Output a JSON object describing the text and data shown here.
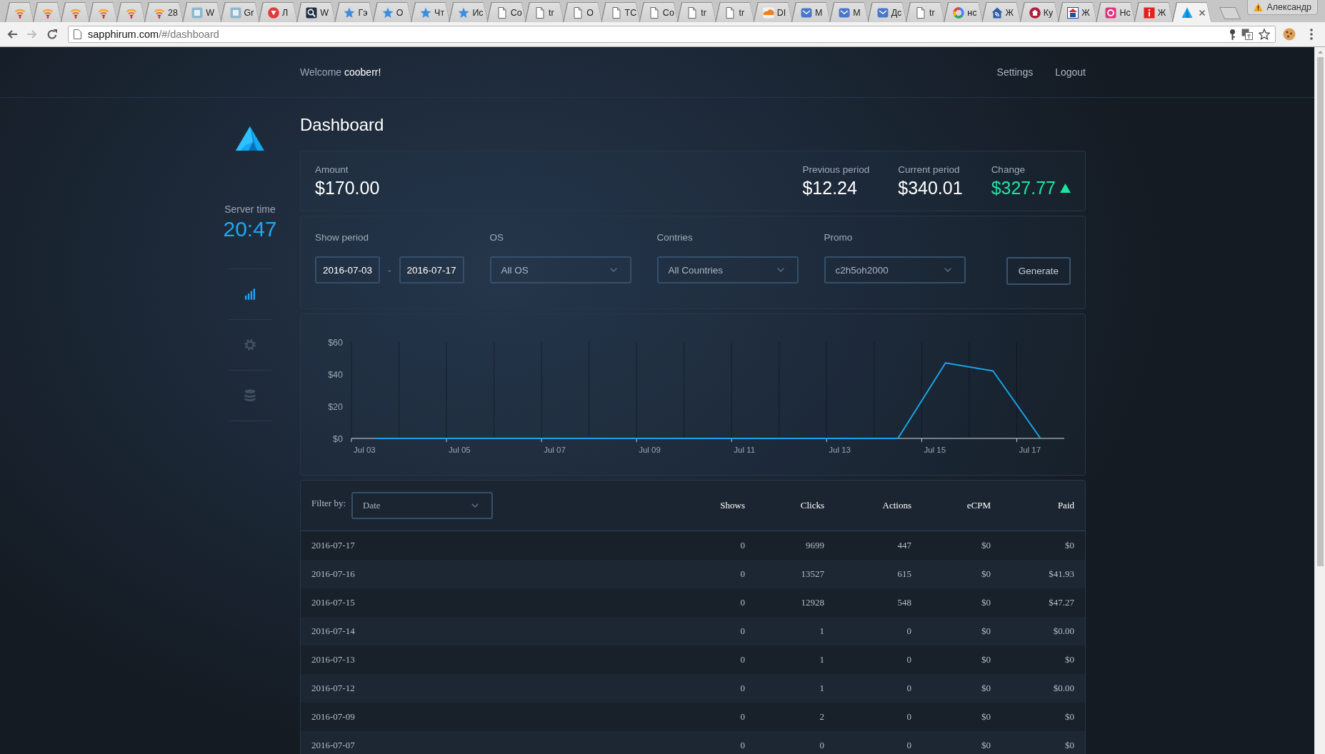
{
  "browser": {
    "tabs": [
      {
        "kind": "feed",
        "pinned": true,
        "selected": false
      },
      {
        "kind": "feed",
        "pinned": true,
        "selected": false
      },
      {
        "kind": "feed",
        "pinned": true,
        "selected": false
      },
      {
        "kind": "feed",
        "pinned": true,
        "selected": false
      },
      {
        "kind": "feed",
        "pinned": true,
        "selected": false
      },
      {
        "kind": "feed",
        "label": "28",
        "pinned": false,
        "selected": false
      },
      {
        "kind": "tile",
        "label": "W",
        "pinned": false,
        "selected": false
      },
      {
        "kind": "tile",
        "label": "Gr",
        "pinned": false,
        "selected": false
      },
      {
        "kind": "badge",
        "label": "Л",
        "pinned": false,
        "selected": false
      },
      {
        "kind": "globe",
        "label": "W",
        "pinned": false,
        "selected": false
      },
      {
        "kind": "star",
        "label": "Гэ",
        "pinned": false,
        "selected": false
      },
      {
        "kind": "star",
        "label": "O",
        "pinned": false,
        "selected": false
      },
      {
        "kind": "star",
        "label": "Чт",
        "pinned": false,
        "selected": false
      },
      {
        "kind": "star",
        "label": "Ис",
        "pinned": false,
        "selected": false
      },
      {
        "kind": "page",
        "label": "Co",
        "pinned": false,
        "selected": false
      },
      {
        "kind": "page",
        "label": "tr",
        "pinned": false,
        "selected": false
      },
      {
        "kind": "page",
        "label": "O",
        "pinned": false,
        "selected": false
      },
      {
        "kind": "page",
        "label": "TC",
        "pinned": false,
        "selected": false
      },
      {
        "kind": "page",
        "label": "Co",
        "pinned": false,
        "selected": false
      },
      {
        "kind": "page",
        "label": "tr",
        "pinned": false,
        "selected": false
      },
      {
        "kind": "page",
        "label": "tr",
        "pinned": false,
        "selected": false
      },
      {
        "kind": "cloud",
        "label": "DI",
        "pinned": false,
        "selected": false
      },
      {
        "kind": "mail",
        "label": "M",
        "pinned": false,
        "selected": false
      },
      {
        "kind": "mail",
        "label": "M",
        "pinned": false,
        "selected": false
      },
      {
        "kind": "mail",
        "label": "Дс",
        "pinned": false,
        "selected": false
      },
      {
        "kind": "page",
        "label": "tr",
        "pinned": false,
        "selected": false
      },
      {
        "kind": "google",
        "label": "нс",
        "pinned": false,
        "selected": false
      },
      {
        "kind": "house",
        "label": "Ж",
        "pinned": false,
        "selected": false
      },
      {
        "kind": "dome",
        "label": "Ку",
        "pinned": false,
        "selected": false
      },
      {
        "kind": "building",
        "label": "Ж",
        "pinned": false,
        "selected": false
      },
      {
        "kind": "ring",
        "label": "Нс",
        "pinned": false,
        "selected": false
      },
      {
        "kind": "info",
        "label": "Ж",
        "pinned": false,
        "selected": false
      },
      {
        "kind": "app",
        "pinned": false,
        "selected": true
      }
    ],
    "profile": "Александр",
    "nav": [
      {
        "kind": "back",
        "disabled": false
      },
      {
        "kind": "forward",
        "disabled": true
      },
      {
        "kind": "reload",
        "disabled": false
      }
    ],
    "address": {
      "host": "sapphirum.com",
      "path": "/#/dashboard"
    }
  },
  "header": {
    "welcome": "Welcome",
    "user": "cooberr!",
    "links": [
      "Settings",
      "Logout"
    ]
  },
  "sidebar": {
    "server_time_label": "Server time",
    "server_time": "20:47",
    "nav": [
      {
        "kind": "stats",
        "selected": true
      },
      {
        "kind": "settings",
        "selected": false
      },
      {
        "kind": "database",
        "selected": false
      }
    ]
  },
  "page_title": "Dashboard",
  "summary": {
    "amount": {
      "label": "Amount",
      "value": "$170.00"
    },
    "periods": [
      {
        "label": "Previous period",
        "value": "$12.24",
        "up": false
      },
      {
        "label": "Current period",
        "value": "$340.01",
        "up": false
      },
      {
        "label": "Change",
        "value": "$327.77",
        "up": true
      }
    ]
  },
  "filters": {
    "period": {
      "label": "Show period",
      "from": "2016-07-03",
      "separator": "-",
      "to": "2016-07-17"
    },
    "selects": [
      {
        "label": "OS",
        "value": "All OS"
      },
      {
        "label": "Contries",
        "value": "All Countries"
      },
      {
        "label": "Promo",
        "value": "c2h5oh2000"
      }
    ],
    "button": "Generate"
  },
  "chart": {
    "chart_data": [
      {
        "type": "line",
        "categories": [
          "Jul 03",
          null,
          "Jul 05",
          null,
          "Jul 07",
          null,
          "Jul 09",
          null,
          "Jul 11",
          null,
          "Jul 13",
          null,
          "Jul 15",
          null,
          "Jul 17"
        ],
        "values": [
          0,
          0,
          0,
          0,
          0,
          0,
          0,
          0,
          0,
          0,
          0,
          0,
          47,
          42,
          0
        ],
        "color": "#1aa3e8",
        "ylim": [
          0,
          60
        ],
        "yticks": [
          {
            "value": 0,
            "label": "$0"
          },
          {
            "value": 20,
            "label": "$20"
          },
          {
            "value": 40,
            "label": "$40"
          },
          {
            "value": 60,
            "label": "$60"
          }
        ],
        "grid": true
      }
    ]
  },
  "table": {
    "columns": [
      {
        "kind": "filter",
        "label": "Filter by:",
        "value": "Date"
      },
      {
        "kind": "text",
        "label": "Shows"
      },
      {
        "kind": "text",
        "label": "Clicks"
      },
      {
        "kind": "text",
        "label": "Actions"
      },
      {
        "kind": "text",
        "label": "eCPM"
      },
      {
        "kind": "text",
        "label": "Paid"
      }
    ],
    "rows": [
      [
        "2016-07-17",
        "0",
        "9699",
        "447",
        "$0",
        "$0"
      ],
      [
        "2016-07-16",
        "0",
        "13527",
        "615",
        "$0",
        "$41.93"
      ],
      [
        "2016-07-15",
        "0",
        "12928",
        "548",
        "$0",
        "$47.27"
      ],
      [
        "2016-07-14",
        "0",
        "1",
        "0",
        "$0",
        "$0.00"
      ],
      [
        "2016-07-13",
        "0",
        "1",
        "0",
        "$0",
        "$0"
      ],
      [
        "2016-07-12",
        "0",
        "1",
        "0",
        "$0",
        "$0.00"
      ],
      [
        "2016-07-09",
        "0",
        "2",
        "0",
        "$0",
        "$0"
      ],
      [
        "2016-07-07",
        "0",
        "0",
        "0",
        "$0",
        "$0"
      ]
    ]
  }
}
